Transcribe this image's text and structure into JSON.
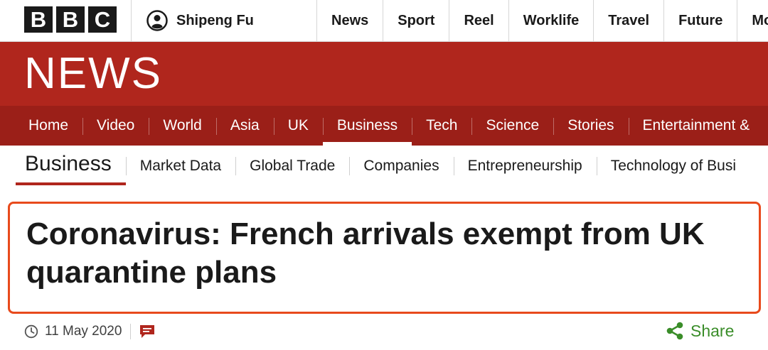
{
  "brand": {
    "logo_letters": [
      "B",
      "B",
      "C"
    ]
  },
  "account": {
    "name": "Shipeng Fu",
    "icon": "user-icon"
  },
  "top_nav": [
    {
      "label": "News"
    },
    {
      "label": "Sport"
    },
    {
      "label": "Reel"
    },
    {
      "label": "Worklife"
    },
    {
      "label": "Travel"
    },
    {
      "label": "Future"
    },
    {
      "label": "Mo"
    }
  ],
  "news_header": {
    "title": "NEWS"
  },
  "main_nav": [
    {
      "label": "Home"
    },
    {
      "label": "Video"
    },
    {
      "label": "World"
    },
    {
      "label": "Asia"
    },
    {
      "label": "UK"
    },
    {
      "label": "Business",
      "active": true
    },
    {
      "label": "Tech"
    },
    {
      "label": "Science"
    },
    {
      "label": "Stories"
    },
    {
      "label": "Entertainment &"
    }
  ],
  "sub_nav": {
    "title": "Business",
    "items": [
      {
        "label": "Market Data"
      },
      {
        "label": "Global Trade"
      },
      {
        "label": "Companies"
      },
      {
        "label": "Entrepreneurship"
      },
      {
        "label": "Technology of Busi"
      }
    ]
  },
  "article": {
    "headline": "Coronavirus: French arrivals exempt from UK quarantine plans",
    "date": "11 May 2020",
    "date_icon": "clock-icon",
    "comment_icon": "comment-icon",
    "share_label": "Share",
    "share_icon": "share-icon"
  },
  "colors": {
    "bbc_red": "#b0261d",
    "nav_red": "#9b1f18",
    "highlight_border": "#e84a1c",
    "share_green": "#3a8d29",
    "text_dark": "#1a1a1a"
  }
}
